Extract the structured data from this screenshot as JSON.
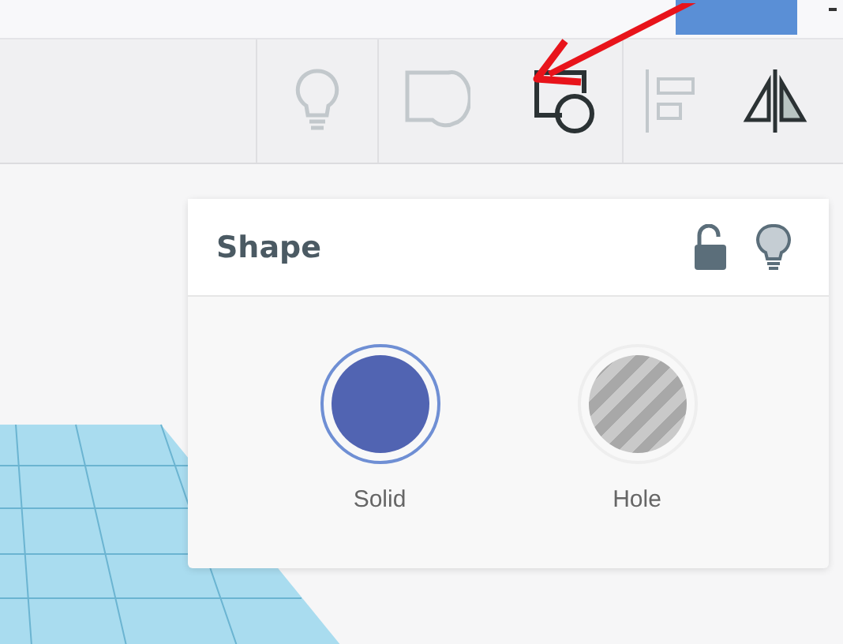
{
  "toolbar": {
    "buttons": [
      {
        "kind": "bulb",
        "disabled": true
      },
      {
        "kind": "shape",
        "disabled": true
      },
      {
        "kind": "group",
        "disabled": false
      },
      {
        "kind": "align",
        "disabled": true
      },
      {
        "kind": "mirror",
        "disabled": false
      }
    ]
  },
  "inspector": {
    "title": "Shape",
    "options": [
      {
        "kind": "solid",
        "label": "Solid",
        "selected": true
      },
      {
        "kind": "hole",
        "label": "Hole",
        "selected": false
      }
    ]
  }
}
